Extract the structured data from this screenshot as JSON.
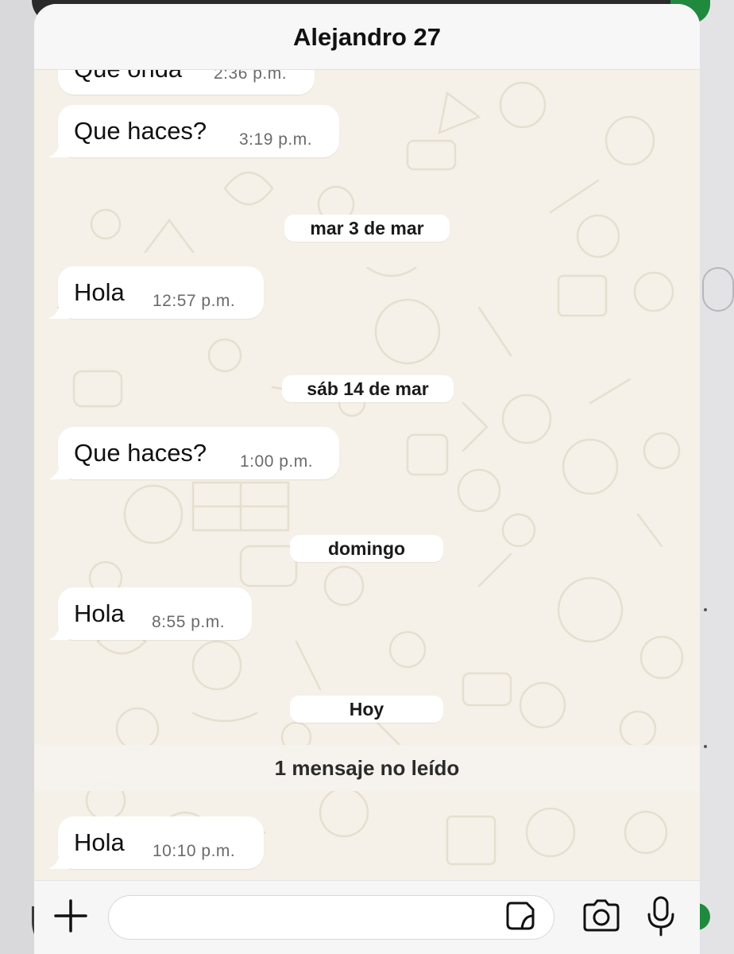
{
  "header": {
    "title": "Alejandro 27"
  },
  "messages": [
    {
      "text": "Que onda",
      "time": "2:36 p.m."
    },
    {
      "text": "Que haces?",
      "time": "3:19 p.m."
    },
    {
      "text": "Hola",
      "time": "12:57 p.m."
    },
    {
      "text": "Que haces?",
      "time": "1:00 p.m."
    },
    {
      "text": "Hola",
      "time": "8:55 p.m."
    },
    {
      "text": "Hola",
      "time": "10:10 p.m."
    }
  ],
  "date_separators": [
    "mar 3 de mar",
    "sáb 14 de mar",
    "domingo",
    "Hoy"
  ],
  "unread": {
    "label": "1 mensaje no leído"
  },
  "composer": {
    "value": ""
  },
  "icons": {
    "plus": "plus-icon",
    "sticker": "sticker-icon",
    "camera": "camera-icon",
    "microphone": "microphone-icon"
  },
  "colors": {
    "chat_background": "#f5f1e8",
    "bubble": "#ffffff",
    "accent_green": "#1f8a3e"
  }
}
